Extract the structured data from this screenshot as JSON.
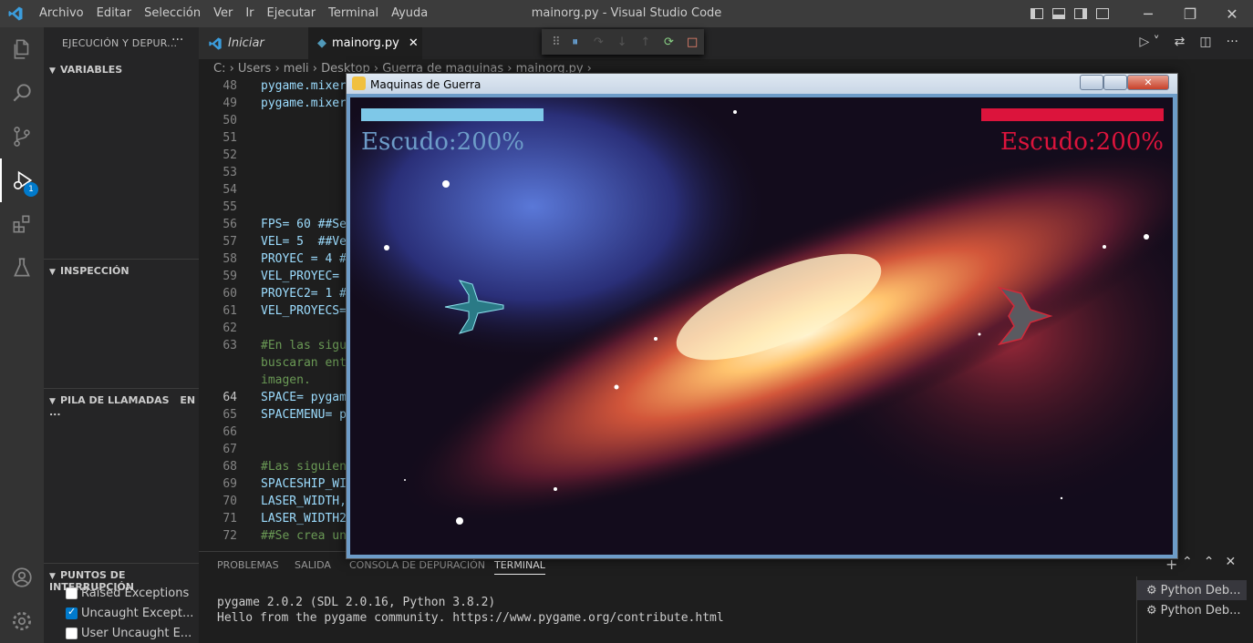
{
  "menubar": {
    "items": [
      "Archivo",
      "Editar",
      "Selección",
      "Ver",
      "Ir",
      "Ejecutar",
      "Terminal",
      "Ayuda"
    ],
    "window_title": "mainorg.py - Visual Studio Code"
  },
  "activity": {
    "debug_badge": "1"
  },
  "sidebar": {
    "title": "EJECUCIÓN Y DEPUR...",
    "more": "···",
    "sections": {
      "variables": "VARIABLES",
      "inspection": "INSPECCIÓN",
      "callstack": "PILA DE LLAMADAS",
      "callstack_extra": "EN ...",
      "breakpoints": "PUNTOS DE INTERRUPCIÓN"
    },
    "breakpoints": [
      {
        "label": "Raised Exceptions",
        "checked": false
      },
      {
        "label": "Uncaught Except...",
        "checked": true
      },
      {
        "label": "User Uncaught E...",
        "checked": false
      }
    ]
  },
  "tabs": [
    {
      "label": "Iniciar"
    },
    {
      "label": "mainorg.py",
      "close": "✕"
    }
  ],
  "breadcrumb": "C: › Users › meli › Desktop › Guerra de maquinas › mainorg.py ›",
  "editor": {
    "lines": [
      {
        "n": "48",
        "text": "pygame.mixer"
      },
      {
        "n": "49",
        "text": "pygame.mixer"
      },
      {
        "n": "50",
        "text": ""
      },
      {
        "n": "51",
        "text": ""
      },
      {
        "n": "52",
        "text": ""
      },
      {
        "n": "53",
        "text": ""
      },
      {
        "n": "54",
        "text": ""
      },
      {
        "n": "55",
        "text": ""
      },
      {
        "n": "56",
        "text": "FPS= 60 ##Se"
      },
      {
        "n": "57",
        "text": "VEL= 5  ##Ve"
      },
      {
        "n": "58",
        "text": "PROYEC = 4 #"
      },
      {
        "n": "59",
        "text": "VEL_PROYEC="
      },
      {
        "n": "60",
        "text": "PROYEC2= 1 #"
      },
      {
        "n": "61",
        "text": "VEL_PROYECS="
      },
      {
        "n": "62",
        "text": ""
      },
      {
        "n": "63",
        "text": "#En las sigu"
      },
      {
        "n": "",
        "text": "buscaran ent"
      },
      {
        "n": "",
        "text": "imagen."
      },
      {
        "n": "64",
        "text": "SPACE= pygam"
      },
      {
        "n": "65",
        "text": "SPACEMENU= p"
      },
      {
        "n": "66",
        "text": ""
      },
      {
        "n": "67",
        "text": ""
      },
      {
        "n": "68",
        "text": "#Las siguien"
      },
      {
        "n": "69",
        "text": "SPACESHIP_WI"
      },
      {
        "n": "70",
        "text": "LASER_WIDTH,"
      },
      {
        "n": "71",
        "text": "LASER_WIDTH2"
      },
      {
        "n": "72",
        "text": "##Se crea un"
      }
    ]
  },
  "panel": {
    "tabs": [
      "PROBLEMAS",
      "SALIDA",
      "CONSOLA DE DEPURACIÓN",
      "TERMINAL"
    ],
    "terminal_lines": [
      "pygame 2.0.2 (SDL 2.0.16, Python 3.8.2)",
      "Hello from the pygame community. https://www.pygame.org/contribute.html"
    ],
    "terminals": [
      "Python Deb...",
      "Python Deb..."
    ]
  },
  "game": {
    "title": "Maquinas de Guerra",
    "left_shield": "Escudo:200%",
    "right_shield": "Escudo:200%",
    "left_color": "#7ec8e8",
    "right_color": "#dc143c"
  },
  "colors": {
    "accent": "#007acc",
    "titlebar": "#3c3c3c",
    "activity": "#333333",
    "sidebar": "#252526"
  }
}
